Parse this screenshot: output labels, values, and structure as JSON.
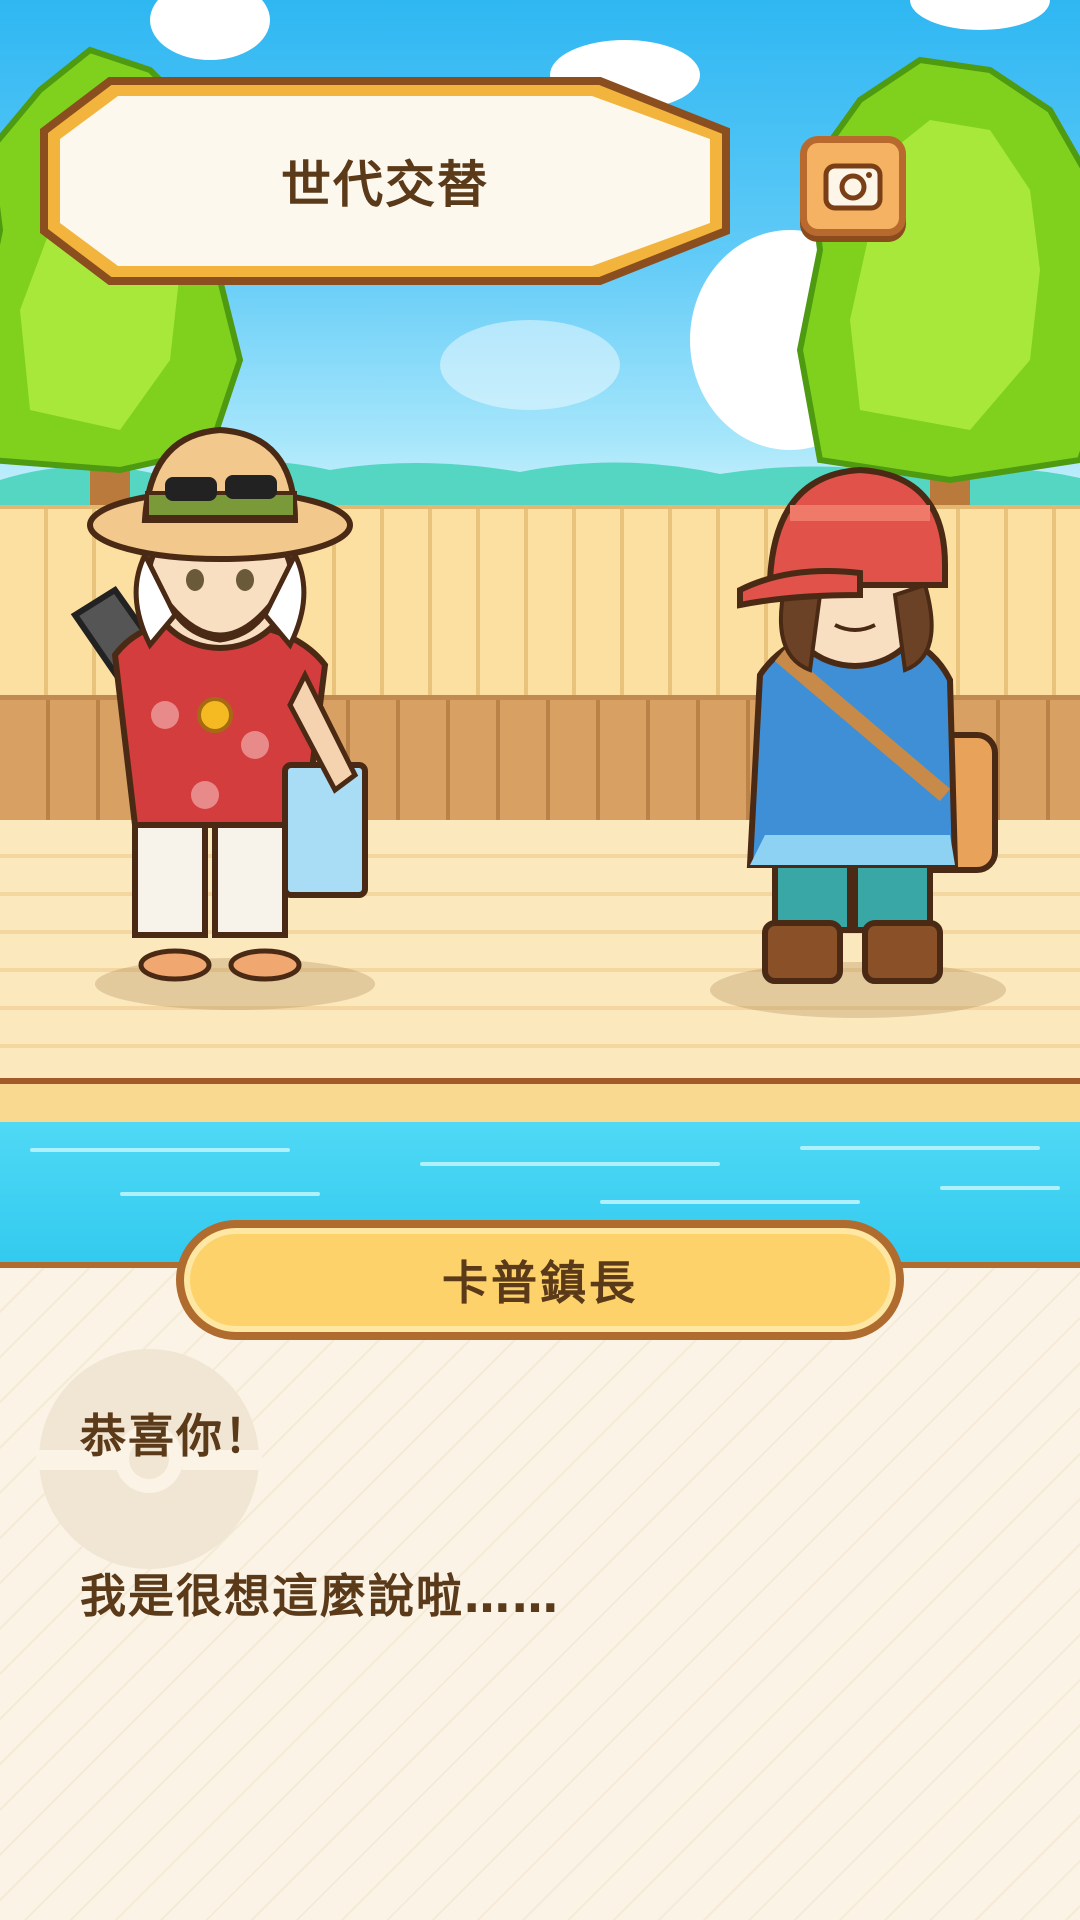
{
  "title": "世代交替",
  "speaker": "卡普鎮長",
  "dialog_lines": [
    "恭喜你！",
    "我是很想這麼說啦……"
  ],
  "icons": {
    "camera": "camera-icon",
    "pokeball": "pokeball-icon"
  },
  "colors": {
    "text": "#5b3a1a",
    "border": "#b06b2f",
    "name_plate": "#fdd26a",
    "dialog_bg": "#fbf4e6"
  }
}
